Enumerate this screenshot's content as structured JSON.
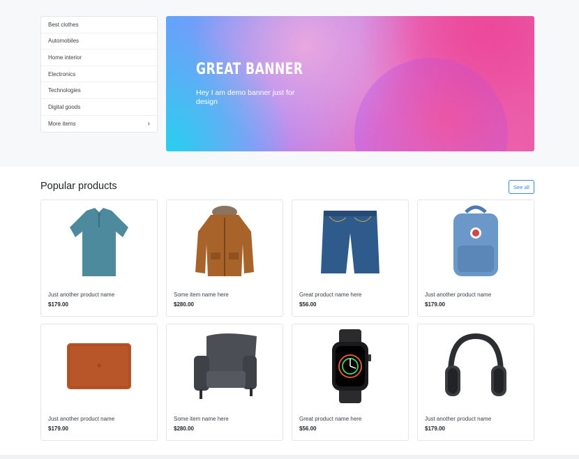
{
  "categories": [
    {
      "label": "Best clothes"
    },
    {
      "label": "Automobiles"
    },
    {
      "label": "Home interior"
    },
    {
      "label": "Electronics"
    },
    {
      "label": "Technologies"
    },
    {
      "label": "Digital goods"
    },
    {
      "label": "More items",
      "chevron": "chevron-right-icon"
    }
  ],
  "banner": {
    "title": "GREAT BANNER",
    "subtitle": "Hey I am demo banner just for design",
    "colors": [
      "#60a5fa",
      "#a78bfa",
      "#e879c9",
      "#ec5ea8",
      "#22d3ee"
    ]
  },
  "popular": {
    "title": "Popular products",
    "see_all": "See all",
    "accent": "#3b82f6"
  },
  "products": [
    {
      "name": "Just another product name",
      "price": "$179.00",
      "image": "polo-shirt"
    },
    {
      "name": "Some item name here",
      "price": "$280.00",
      "image": "jacket"
    },
    {
      "name": "Great product name here",
      "price": "$56.00",
      "image": "denim-shorts"
    },
    {
      "name": "Just another product name",
      "price": "$179.00",
      "image": "backpack"
    },
    {
      "name": "Just another product name",
      "price": "$179.00",
      "image": "laptop-sleeve"
    },
    {
      "name": "Some item name here",
      "price": "$280.00",
      "image": "armchair"
    },
    {
      "name": "Great product name here",
      "price": "$56.00",
      "image": "smartwatch"
    },
    {
      "name": "Just another product name",
      "price": "$179.00",
      "image": "headphones"
    }
  ]
}
